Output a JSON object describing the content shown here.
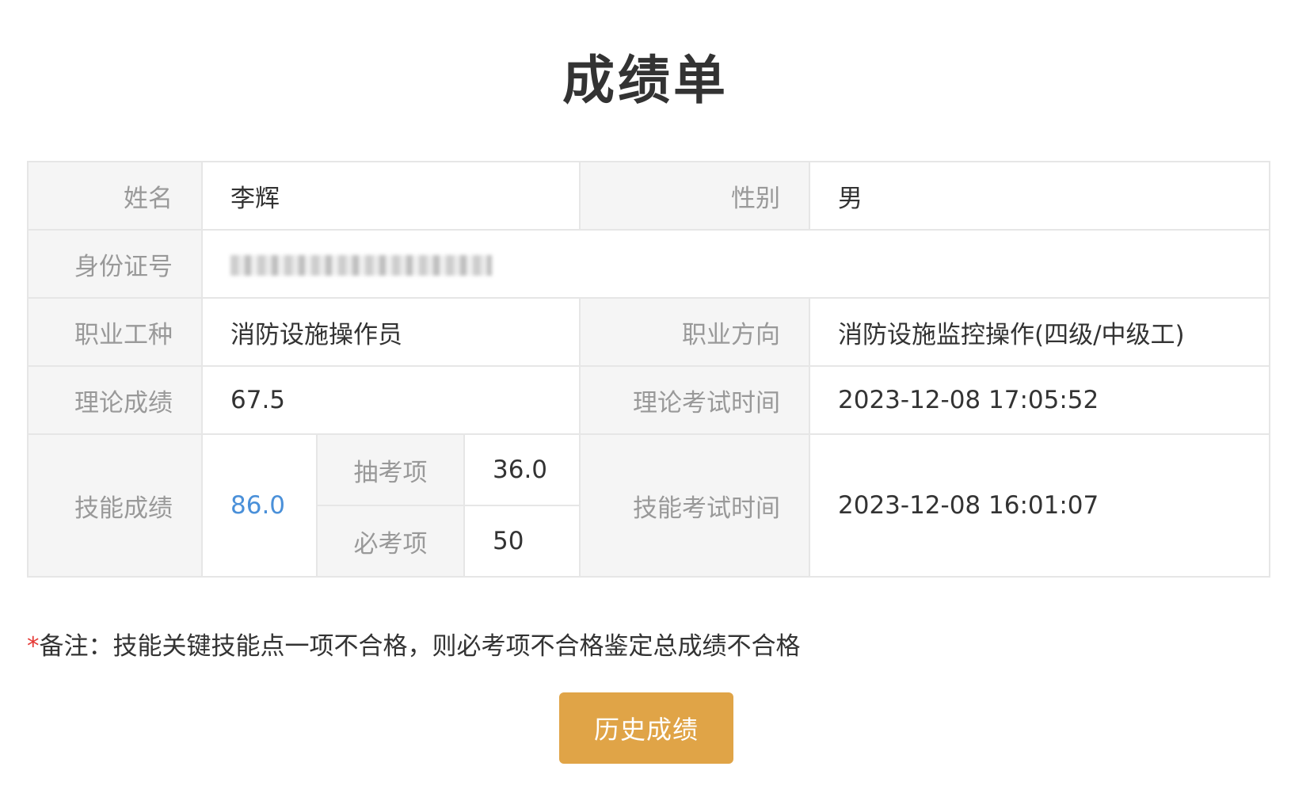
{
  "page": {
    "title": "成绩单"
  },
  "record": {
    "name_label": "姓名",
    "name_value": "李辉",
    "gender_label": "性别",
    "gender_value": "男",
    "id_label": "身份证号",
    "occupation_label": "职业工种",
    "occupation_value": "消防设施操作员",
    "direction_label": "职业方向",
    "direction_value": "消防设施监控操作(四级/中级工)",
    "theory_score_label": "理论成绩",
    "theory_score_value": "67.5",
    "theory_time_label": "理论考试时间",
    "theory_time_value": "2023-12-08 17:05:52",
    "skill_score_label": "技能成绩",
    "skill_score_value": "86.0",
    "sampled_item_label": "抽考项",
    "sampled_item_value": "36.0",
    "required_item_label": "必考项",
    "required_item_value": "50",
    "skill_time_label": "技能考试时间",
    "skill_time_value": "2023-12-08 16:01:07"
  },
  "note": {
    "star": "*",
    "text": "备注：技能关键技能点一项不合格，则必考项不合格鉴定总成绩不合格"
  },
  "actions": {
    "history_label": "历史成绩"
  },
  "colors": {
    "accent_button": "#e0a447",
    "skill_score": "#4a90d9",
    "required_star": "#e53935"
  }
}
